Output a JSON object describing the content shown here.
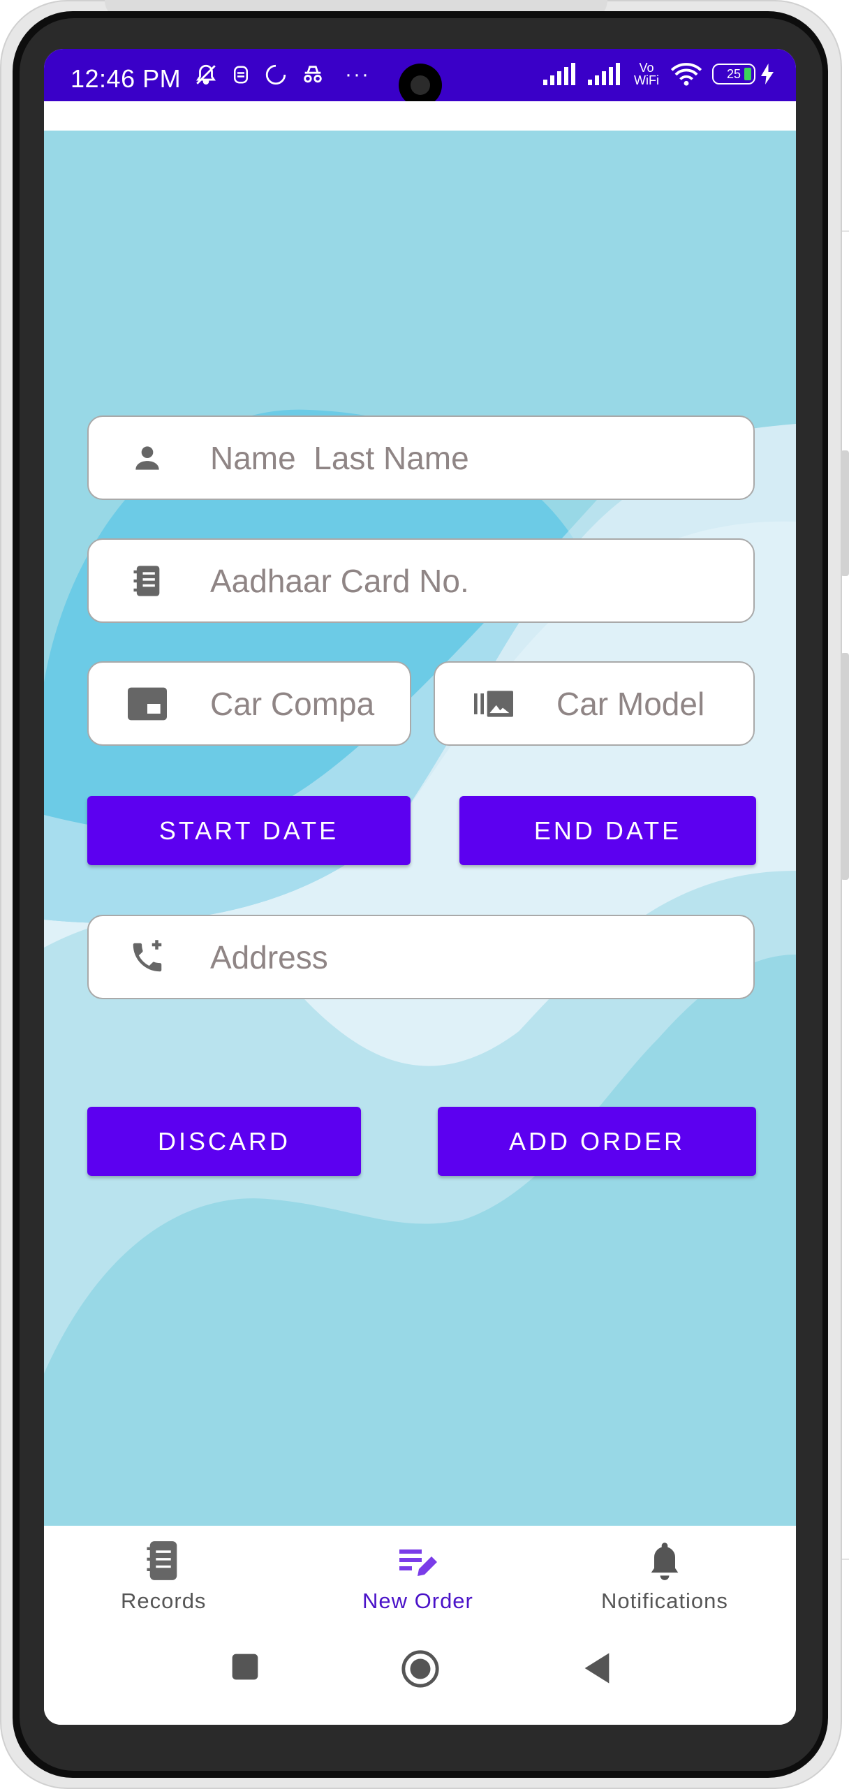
{
  "status_bar": {
    "time": "12:46 PM",
    "battery": "25",
    "network_label": "Vo WiFi",
    "overflow": "···"
  },
  "form": {
    "name_placeholder": "Name  Last Name",
    "aadhaar_placeholder": "Aadhaar Card No.",
    "car_company_placeholder": "Car Compa",
    "car_model_placeholder": "Car Model",
    "start_date_label": "START DATE",
    "end_date_label": "END DATE",
    "address_placeholder": "Address",
    "discard_label": "DISCARD",
    "add_order_label": "ADD ORDER"
  },
  "bottom_nav": {
    "items": [
      {
        "label": "Records",
        "icon": "records-icon",
        "active": false
      },
      {
        "label": "New Order",
        "icon": "edit-list-icon",
        "active": true
      },
      {
        "label": "Notifications",
        "icon": "bell-icon",
        "active": false
      }
    ]
  },
  "colors": {
    "status_bar": "#3a00c8",
    "primary_button": "#5c00f0",
    "active_nav": "#4a12c8",
    "background": "#98d8e6"
  }
}
